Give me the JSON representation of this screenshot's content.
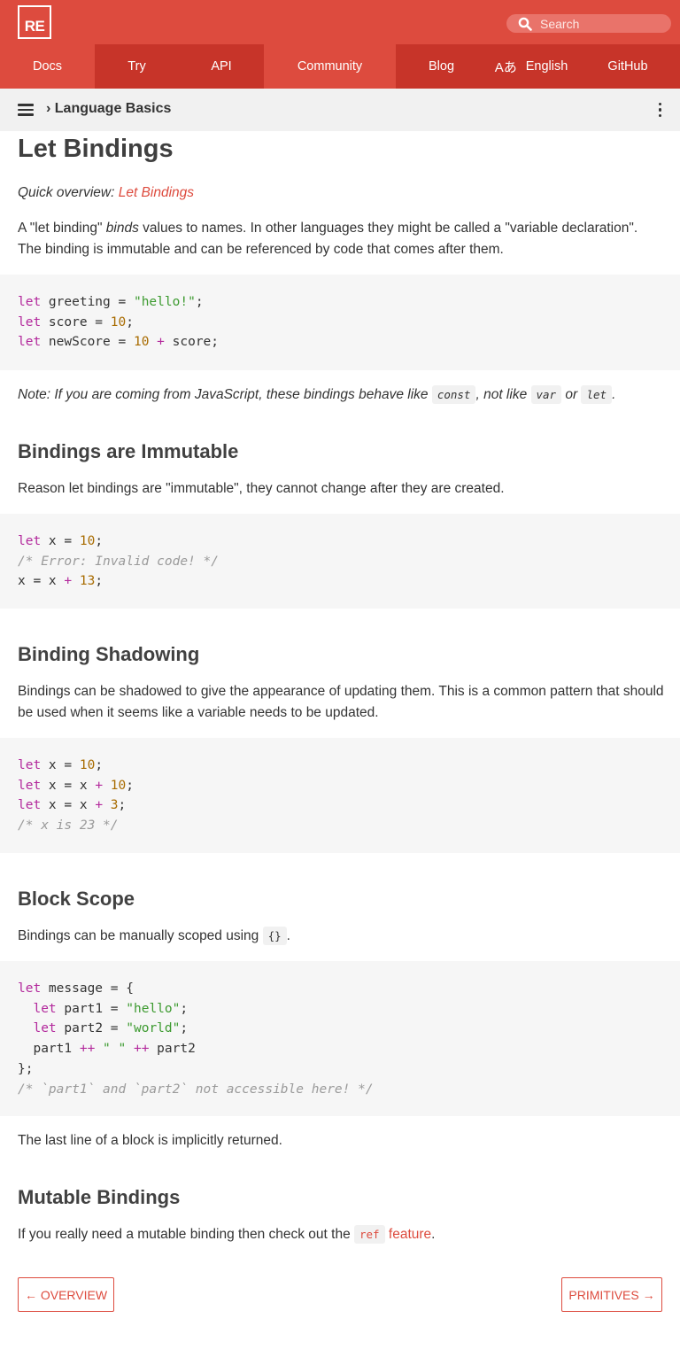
{
  "header": {
    "logo_text": "RE",
    "search_placeholder": "Search",
    "nav": {
      "docs": "Docs",
      "try": "Try",
      "api": "API",
      "community": "Community",
      "blog": "Blog",
      "language_glyph": "Aあ",
      "language": "English",
      "github": "GitHub"
    },
    "colors": {
      "primary": "#dd4b3e",
      "dark": "#c73429"
    }
  },
  "breadcrumb": {
    "text": "› Language Basics"
  },
  "page": {
    "title": "Let Bindings",
    "quick_prefix": "Quick overview: ",
    "quick_link": "Let Bindings",
    "intro_1": "A \"let binding\" ",
    "intro_em": "binds",
    "intro_2": " values to names. In other languages they might be called a \"variable declaration\". The binding is immutable and can be referenced by code that comes after them.",
    "note_1": "Note: If you are coming from JavaScript, these bindings behave like ",
    "note_const": "const",
    "note_2": ", not like ",
    "note_var": "var",
    "note_3": " or ",
    "note_let": "let",
    "note_4": ".",
    "sections": {
      "immutable": {
        "heading": "Bindings are Immutable",
        "text": "Reason let bindings are \"immutable\", they cannot change after they are created."
      },
      "shadowing": {
        "heading": "Binding Shadowing",
        "text": "Bindings can be shadowed to give the appearance of updating them. This is a common pattern that should be used when it seems like a variable needs to be updated."
      },
      "block": {
        "heading": "Block Scope",
        "text_1": "Bindings can be manually scoped using ",
        "code": "{}",
        "text_2": ".",
        "after": "The last line of a block is implicitly returned."
      },
      "mutable": {
        "heading": "Mutable Bindings",
        "text_1": "If you really need a mutable binding then check out the ",
        "code": "ref",
        "link": "feature",
        "text_2": "."
      }
    }
  },
  "pager": {
    "prev": "← OVERVIEW",
    "next": "PRIMITIVES →"
  }
}
